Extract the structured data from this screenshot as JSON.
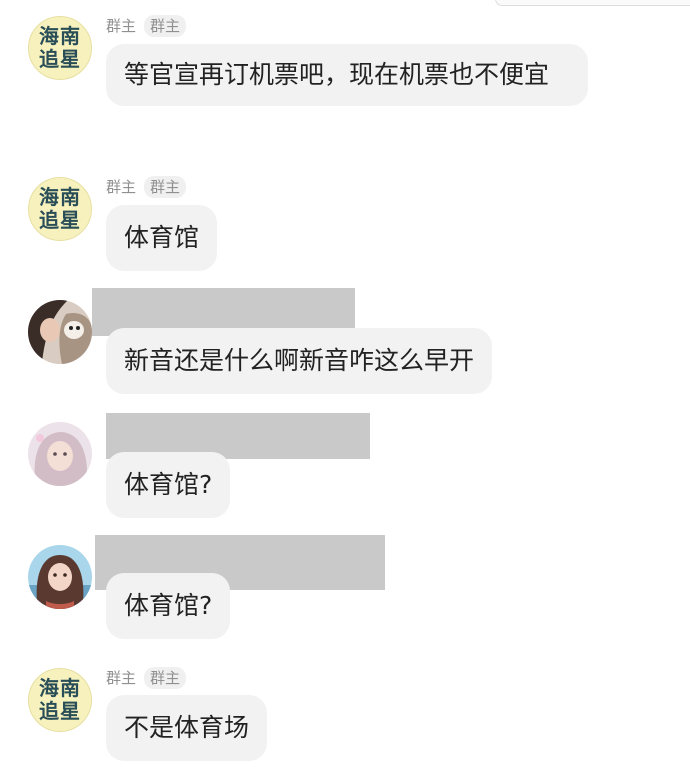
{
  "chat": {
    "messages": [
      {
        "sender_avatar_text": [
          "海南",
          "追星"
        ],
        "badges": [
          "群主",
          "群主"
        ],
        "text": "等官宣再订机票吧，现在机票也不便宜"
      },
      {
        "sender_avatar_text": [
          "海南",
          "追星"
        ],
        "badges": [
          "群主",
          "群主"
        ],
        "text": "体育馆"
      },
      {
        "text": "新音还是什么啊新音咋这么早开"
      },
      {
        "text": "体育馆?"
      },
      {
        "text": "体育馆?"
      },
      {
        "sender_avatar_text": [
          "海南",
          "追星"
        ],
        "badges": [
          "群主",
          "群主"
        ],
        "text": "不是体育场"
      }
    ]
  },
  "colors": {
    "bubble": "#f2f2f2",
    "text": "#222222",
    "badge_text": "#909090",
    "redaction": "#c9c9c9",
    "brand_avatar_bg": "#f7f1bd",
    "brand_avatar_text": "#2a4e58"
  }
}
